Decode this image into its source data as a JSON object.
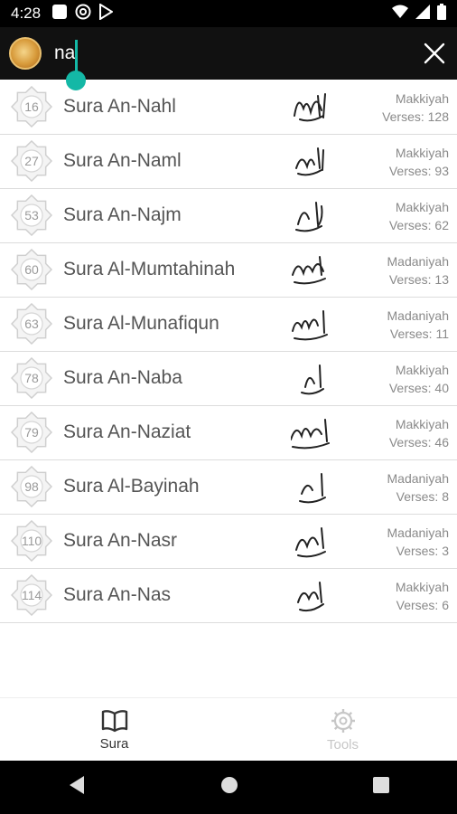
{
  "status_bar": {
    "time": "4:28"
  },
  "search": {
    "query": "na"
  },
  "suras": [
    {
      "number": "16",
      "name": "Sura An-Nahl",
      "type": "Makkiyah",
      "verses": "Verses: 128"
    },
    {
      "number": "27",
      "name": "Sura An-Naml",
      "type": "Makkiyah",
      "verses": "Verses: 93"
    },
    {
      "number": "53",
      "name": "Sura An-Najm",
      "type": "Makkiyah",
      "verses": "Verses: 62"
    },
    {
      "number": "60",
      "name": "Sura Al-Mumtahinah",
      "type": "Madaniyah",
      "verses": "Verses: 13"
    },
    {
      "number": "63",
      "name": "Sura Al-Munafiqun",
      "type": "Madaniyah",
      "verses": "Verses: 11"
    },
    {
      "number": "78",
      "name": "Sura An-Naba",
      "type": "Makkiyah",
      "verses": "Verses: 40"
    },
    {
      "number": "79",
      "name": "Sura An-Naziat",
      "type": "Makkiyah",
      "verses": "Verses: 46"
    },
    {
      "number": "98",
      "name": "Sura Al-Bayinah",
      "type": "Madaniyah",
      "verses": "Verses: 8"
    },
    {
      "number": "110",
      "name": "Sura An-Nasr",
      "type": "Madaniyah",
      "verses": "Verses: 3"
    },
    {
      "number": "114",
      "name": "Sura An-Nas",
      "type": "Makkiyah",
      "verses": "Verses: 6"
    }
  ],
  "bottom_nav": {
    "sura_label": "Sura",
    "tools_label": "Tools"
  },
  "colors": {
    "accent": "#14b8a6",
    "toolbar": "#111111",
    "nav_active": "#333333",
    "nav_inactive": "#c7c7c7"
  },
  "icons": {
    "status": [
      "square-icon",
      "at-icon",
      "play-store-icon",
      "wifi-icon",
      "signal-icon",
      "battery-icon"
    ],
    "toolbar": [
      "app-logo",
      "close-icon"
    ],
    "nav": [
      "book-icon",
      "gear-icon",
      "back-icon",
      "home-icon",
      "recents-icon"
    ]
  }
}
